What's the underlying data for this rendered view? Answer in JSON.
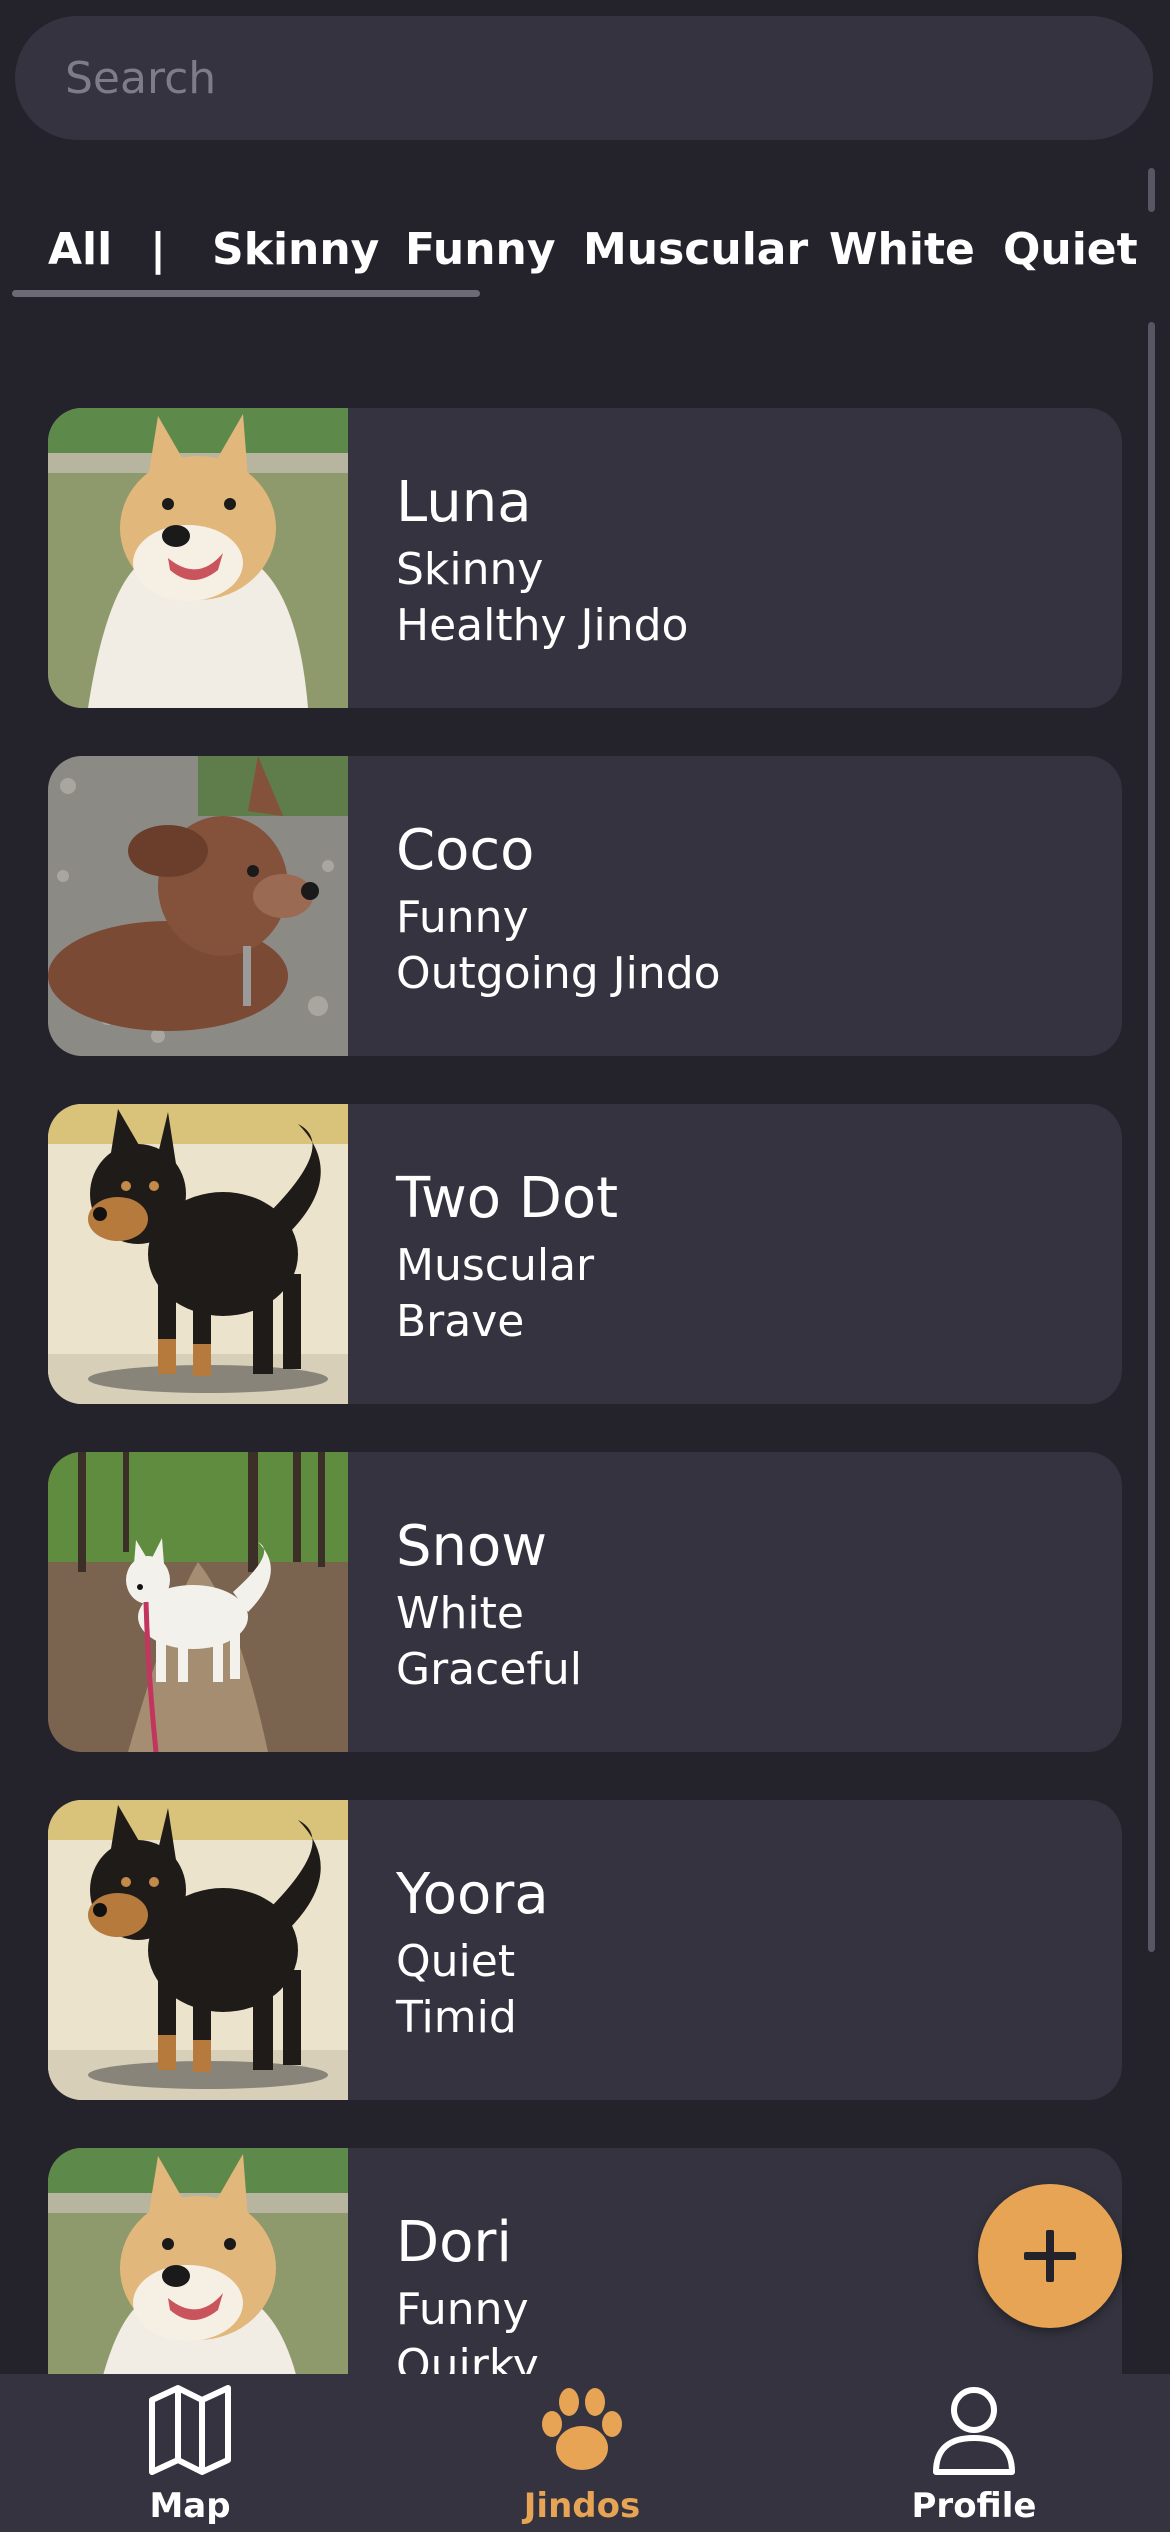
{
  "search": {
    "placeholder": "Search"
  },
  "filters": {
    "tabs": [
      "All",
      "Skinny",
      "Funny",
      "Muscular",
      "White",
      "Quiet"
    ],
    "separator": "|",
    "selected": "All"
  },
  "jindos": [
    {
      "name": "Luna",
      "trait": "Skinny",
      "description": "Healthy Jindo",
      "photo_icon": "tan-jindo-photo"
    },
    {
      "name": "Coco",
      "trait": "Funny",
      "description": "Outgoing Jindo",
      "photo_icon": "brown-jindo-photo"
    },
    {
      "name": "Two Dot",
      "trait": "Muscular",
      "description": "Brave",
      "photo_icon": "black-tan-jindo-photo"
    },
    {
      "name": "Snow",
      "trait": "White",
      "description": "Graceful",
      "photo_icon": "white-jindo-photo"
    },
    {
      "name": "Yoora",
      "trait": "Quiet",
      "description": "Timid",
      "photo_icon": "black-tan-jindo-photo"
    },
    {
      "name": "Dori",
      "trait": "Funny",
      "description": "Quirky",
      "photo_icon": "tan-jindo-photo"
    }
  ],
  "fab": {
    "icon": "plus-icon"
  },
  "bottom_nav": {
    "items": [
      {
        "label": "Map",
        "icon": "map-icon"
      },
      {
        "label": "Jindos",
        "icon": "paw-icon",
        "active": true
      },
      {
        "label": "Profile",
        "icon": "person-icon"
      }
    ]
  },
  "colors": {
    "background": "#24232b",
    "surface": "#34333f",
    "accent": "#e6a454",
    "text": "#ffffff",
    "muted": "#7e7c88"
  }
}
